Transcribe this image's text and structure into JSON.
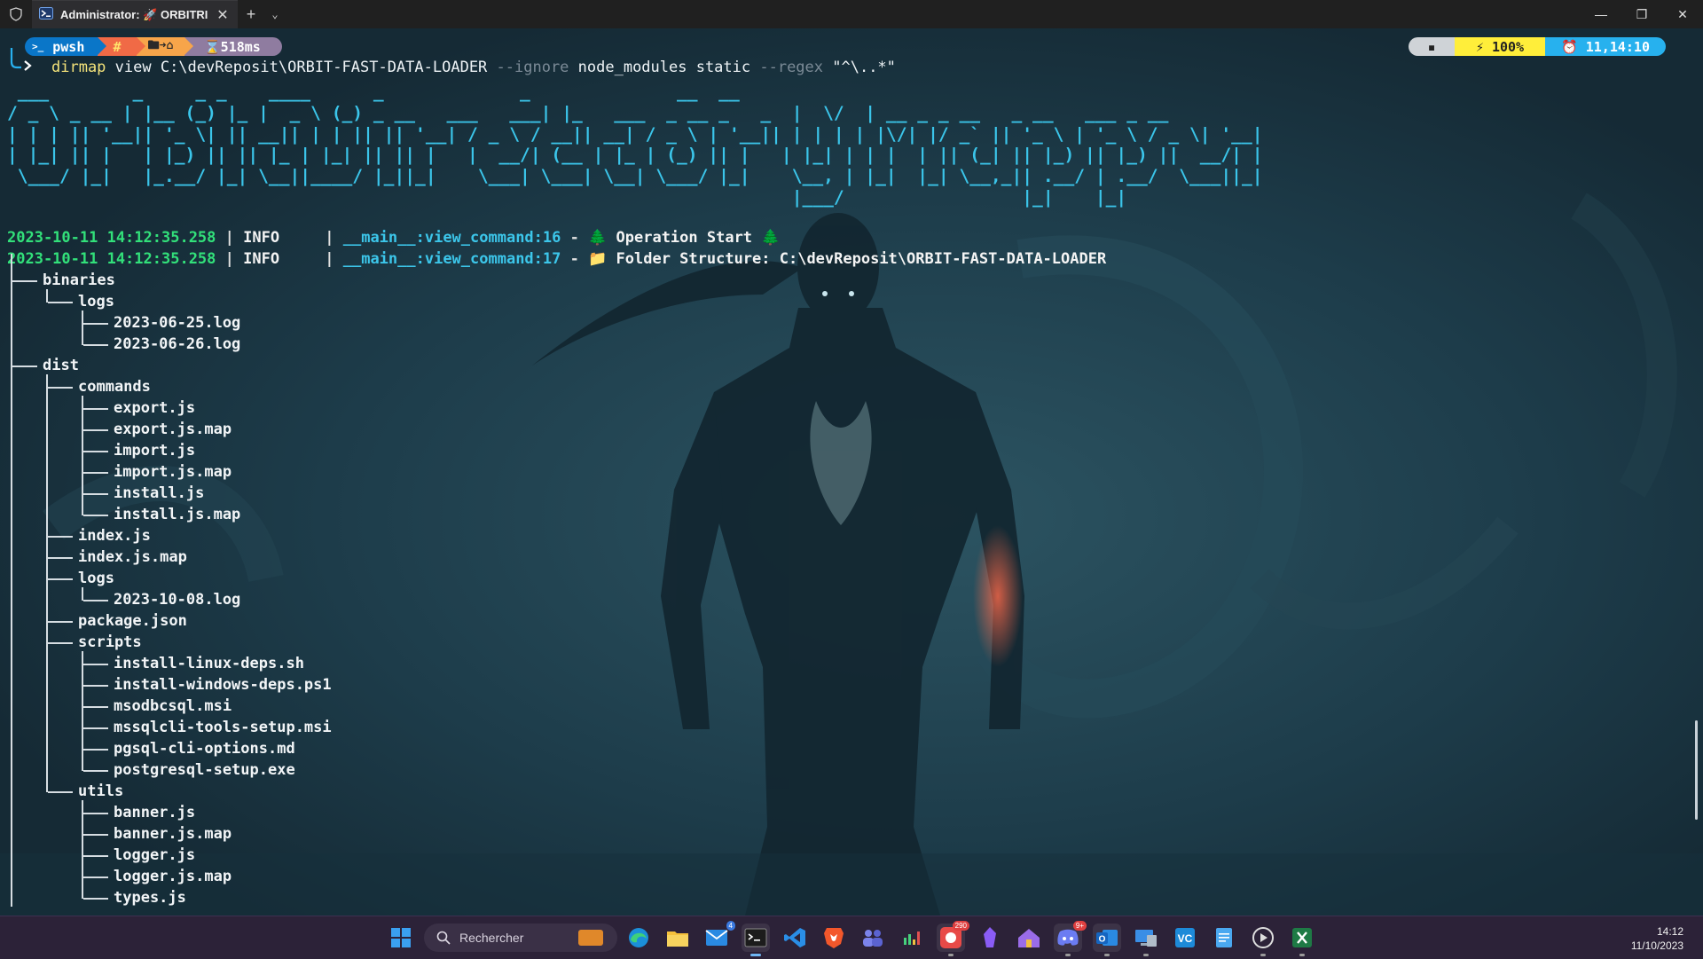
{
  "window": {
    "tab_title": "Administrator: 🚀 ORBITRIX | ",
    "new_tab": "+",
    "dropdown": "⌄",
    "close_tab": "✕",
    "minimize": "—",
    "maximize": "❐",
    "close": "✕"
  },
  "prompt": {
    "shell": "pwsh",
    "shell_icon": ">_",
    "status_glyph": "#",
    "folder_glyph": "🖿➜⌂",
    "exec_time": "⌛518ms",
    "battery_glyph": "▪",
    "battery_pct": "⚡ 100%",
    "clock": "⏰ 11,14:10"
  },
  "command": {
    "program": "dirmap",
    "args": " view C:\\devReposit\\ORBIT-FAST-DATA-LOADER ",
    "flag_ignore": "--ignore",
    "ignore_values": " node_modules static ",
    "flag_regex": "--regex",
    "regex_value": " \"^\\..*\""
  },
  "banner": " ___        _     _ _    ____      _             _              __  __\n/ _ \\ _ __ | |__ (_) |_ |  _ \\ (_) _ __   ___   ___| |_   ___  _ __ _   _  |  \\/  | __ _ _ __   _ __   ___ _ __\n| | | || '__|| '_ \\| || __|| | | || || '__| / _ \\ / __|| __| / _ \\ | '__|| | | | | |\\/| |/ _` || '_ \\ | '_ \\ / _ \\| '__|\n| |_| || |   | |_) || || |_ | |_| || || |   |  __/| (__ | |_ | (_) || |   | |_| | | |  | || (_| || |_) || |_) ||  __/| |\n \\___/ |_|   |_.__/ |_| \\__||____/ |_||_|    \\___| \\___| \\__| \\___/ |_|    \\__, | |_|  |_| \\__,_|| .__/ | .__/  \\___||_|\n                                                                           |___/                 |_|    |_|",
  "logs": [
    {
      "timestamp": "2023-10-11 14:12:35.258",
      "level": "INFO    ",
      "module": "__main__:view_command:16",
      "icon": "🌲",
      "message": "Operation Start",
      "icon_end": " 🌲"
    },
    {
      "timestamp": "2023-10-11 14:12:35.258",
      "level": "INFO    ",
      "module": "__main__:view_command:17",
      "icon": "📁",
      "message": "Folder Structure: C:\\devReposit\\ORBIT-FAST-DATA-LOADER",
      "icon_end": ""
    }
  ],
  "tree": [
    {
      "name": "binaries",
      "depth": 0,
      "type": "dir"
    },
    {
      "name": "logs",
      "depth": 1,
      "type": "dir"
    },
    {
      "name": "2023-06-25.log",
      "depth": 2,
      "type": "file"
    },
    {
      "name": "2023-06-26.log",
      "depth": 2,
      "type": "file"
    },
    {
      "name": "dist",
      "depth": 0,
      "type": "dir"
    },
    {
      "name": "commands",
      "depth": 1,
      "type": "dir"
    },
    {
      "name": "export.js",
      "depth": 2,
      "type": "file"
    },
    {
      "name": "export.js.map",
      "depth": 2,
      "type": "file"
    },
    {
      "name": "import.js",
      "depth": 2,
      "type": "file"
    },
    {
      "name": "import.js.map",
      "depth": 2,
      "type": "file"
    },
    {
      "name": "install.js",
      "depth": 2,
      "type": "file"
    },
    {
      "name": "install.js.map",
      "depth": 2,
      "type": "file"
    },
    {
      "name": "index.js",
      "depth": 1,
      "type": "file"
    },
    {
      "name": "index.js.map",
      "depth": 1,
      "type": "file"
    },
    {
      "name": "logs",
      "depth": 1,
      "type": "dir"
    },
    {
      "name": "2023-10-08.log",
      "depth": 2,
      "type": "file"
    },
    {
      "name": "package.json",
      "depth": 1,
      "type": "file"
    },
    {
      "name": "scripts",
      "depth": 1,
      "type": "dir"
    },
    {
      "name": "install-linux-deps.sh",
      "depth": 2,
      "type": "file"
    },
    {
      "name": "install-windows-deps.ps1",
      "depth": 2,
      "type": "file"
    },
    {
      "name": "msodbcsql.msi",
      "depth": 2,
      "type": "file"
    },
    {
      "name": "mssqlcli-tools-setup.msi",
      "depth": 2,
      "type": "file"
    },
    {
      "name": "pgsql-cli-options.md",
      "depth": 2,
      "type": "file"
    },
    {
      "name": "postgresql-setup.exe",
      "depth": 2,
      "type": "file"
    },
    {
      "name": "utils",
      "depth": 1,
      "type": "dir"
    },
    {
      "name": "banner.js",
      "depth": 2,
      "type": "file"
    },
    {
      "name": "banner.js.map",
      "depth": 2,
      "type": "file"
    },
    {
      "name": "logger.js",
      "depth": 2,
      "type": "file"
    },
    {
      "name": "logger.js.map",
      "depth": 2,
      "type": "file"
    },
    {
      "name": "types.js",
      "depth": 2,
      "type": "file"
    }
  ],
  "taskbar": {
    "search_placeholder": "Rechercher",
    "time": "14:12",
    "date": "11/10/2023",
    "apps": [
      {
        "name": "start-icon"
      },
      {
        "name": "edge-icon"
      },
      {
        "name": "file-explorer-icon"
      },
      {
        "name": "mail-icon",
        "badge": "4"
      },
      {
        "name": "terminal-icon",
        "active": true
      },
      {
        "name": "vscode-icon"
      },
      {
        "name": "brave-icon"
      },
      {
        "name": "teams-icon"
      },
      {
        "name": "audio-meter-icon"
      },
      {
        "name": "chrome-icon",
        "badge": "290"
      },
      {
        "name": "obsidian-icon"
      },
      {
        "name": "home-app-icon"
      },
      {
        "name": "discord-icon",
        "badge": "9+"
      },
      {
        "name": "outlook-icon"
      },
      {
        "name": "remote-desktop-icon"
      },
      {
        "name": "vc-app-icon"
      },
      {
        "name": "notepad-icon"
      },
      {
        "name": "media-player-icon"
      },
      {
        "name": "excel-icon"
      }
    ]
  },
  "colors": {
    "background": "#18303c",
    "banner": "#3bc5ea",
    "timestamp": "#32e07a",
    "module": "#3cc6ea",
    "prompt_pwsh": "#0a76c8",
    "prompt_time": "#8f7ca0",
    "clock_segment": "#27b1ee",
    "battery_segment": "#ffee3a"
  }
}
